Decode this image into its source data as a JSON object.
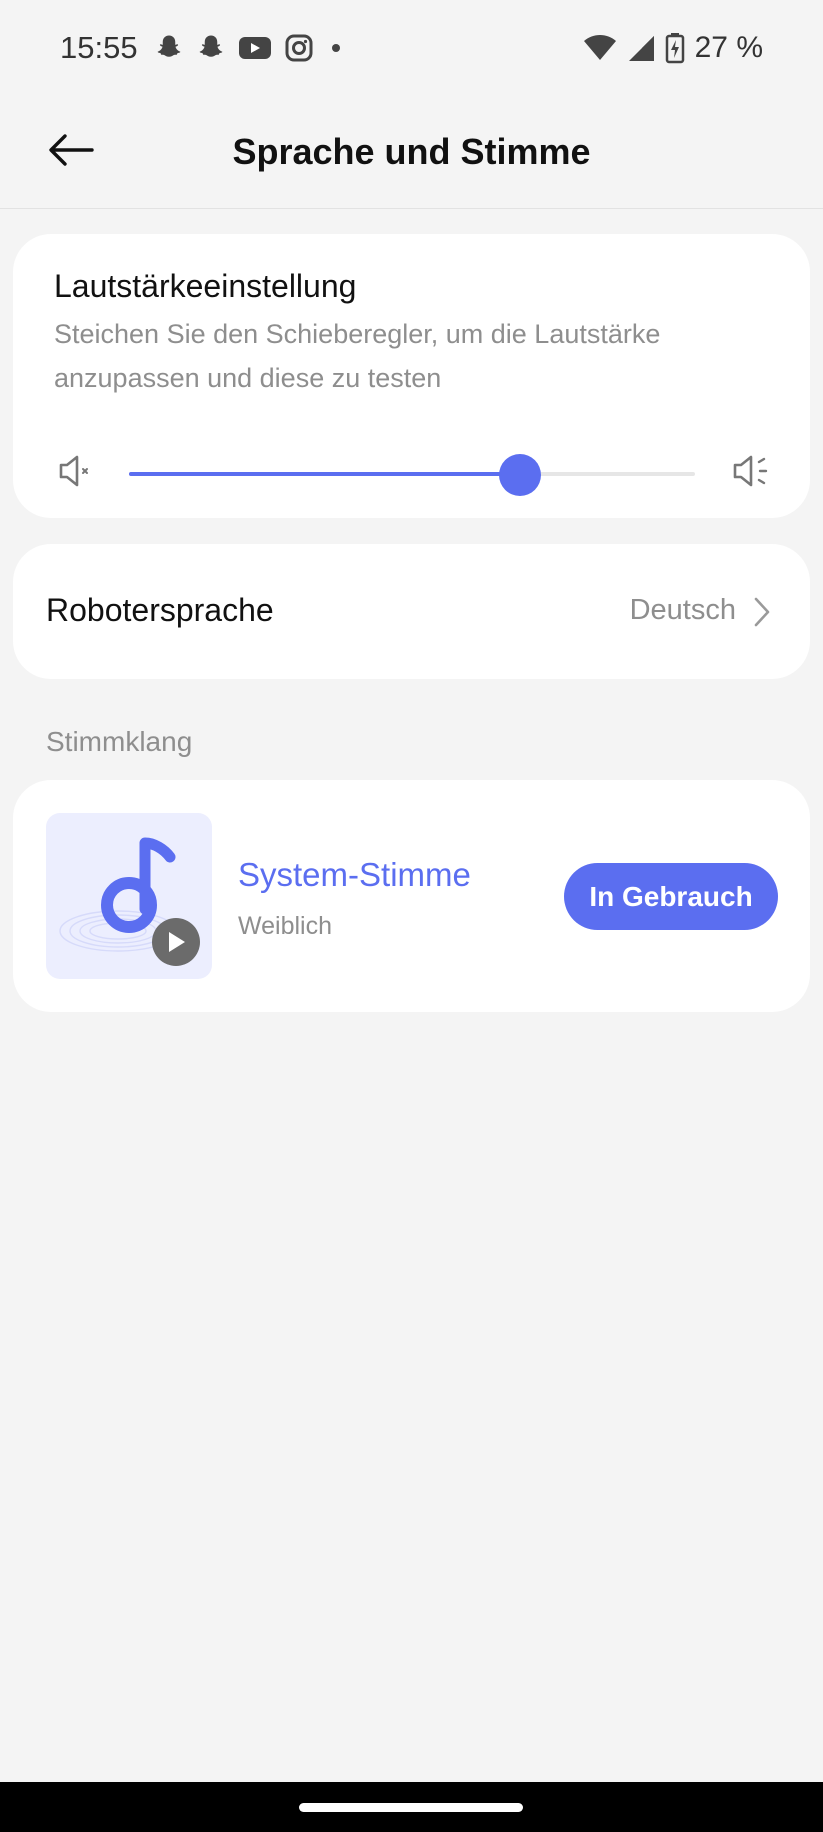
{
  "status_bar": {
    "time": "15:55",
    "battery": "27 %",
    "icons": [
      "snapchat-icon",
      "snapchat-icon",
      "youtube-icon",
      "instagram-icon",
      "dot-icon",
      "wifi-icon",
      "signal-icon",
      "battery-charging-icon"
    ]
  },
  "header": {
    "title": "Sprache und Stimme",
    "back_icon": "arrow-left-icon"
  },
  "volume": {
    "title": "Lautstärkeeinstellung",
    "description": "Steichen Sie den Schieberegler, um die Lautstärke anzupassen und diese zu testen",
    "level": 0.69,
    "min_icon": "volume-mute-icon",
    "max_icon": "volume-up-icon"
  },
  "language": {
    "label": "Robotersprache",
    "value": "Deutsch"
  },
  "voice_section": {
    "label": "Stimmklang",
    "voice_name": "System-Stimme",
    "voice_gender": "Weiblich",
    "button_label": "In Gebrauch"
  },
  "colors": {
    "accent": "#5b6ef0",
    "background": "#f4f4f4",
    "card": "#ffffff",
    "muted_text": "#8e8e8e"
  }
}
